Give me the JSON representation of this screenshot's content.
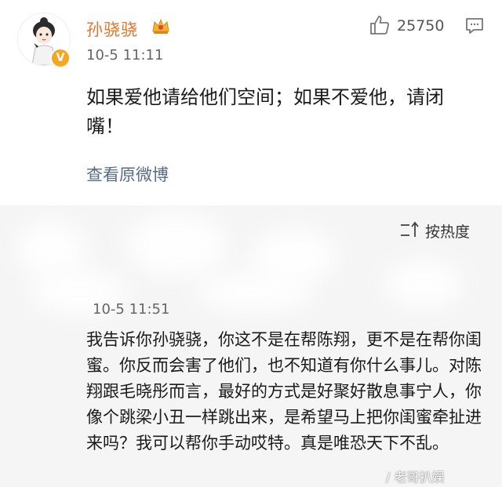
{
  "post": {
    "username": "孙骁骁",
    "time": "10-5 11:11",
    "likes": "25750",
    "text": "如果爱他请给他们空间；如果不爱他，请闭嘴！",
    "view_original": "查看原微博",
    "verified_mark": "V",
    "badge_icon": "crown-vip-icon",
    "accent": "#e0772b"
  },
  "comments": {
    "sort_label": "按热度",
    "item": {
      "time": "10-5 11:51",
      "text": "我告诉你孙骁骁，你这不是在帮陈翔，更不是在帮你闺蜜。你反而会害了他们，也不知道有你什么事儿。对陈翔跟毛晓彤而言，最好的方式是好聚好散息事宁人，你像个跳梁小丑一样跳出来，是希望马上把你闺蜜牵扯进来吗？我可以帮你手动哎特。真是唯恐天下不乱。"
    }
  },
  "watermark": "/ 老哥扒娱"
}
